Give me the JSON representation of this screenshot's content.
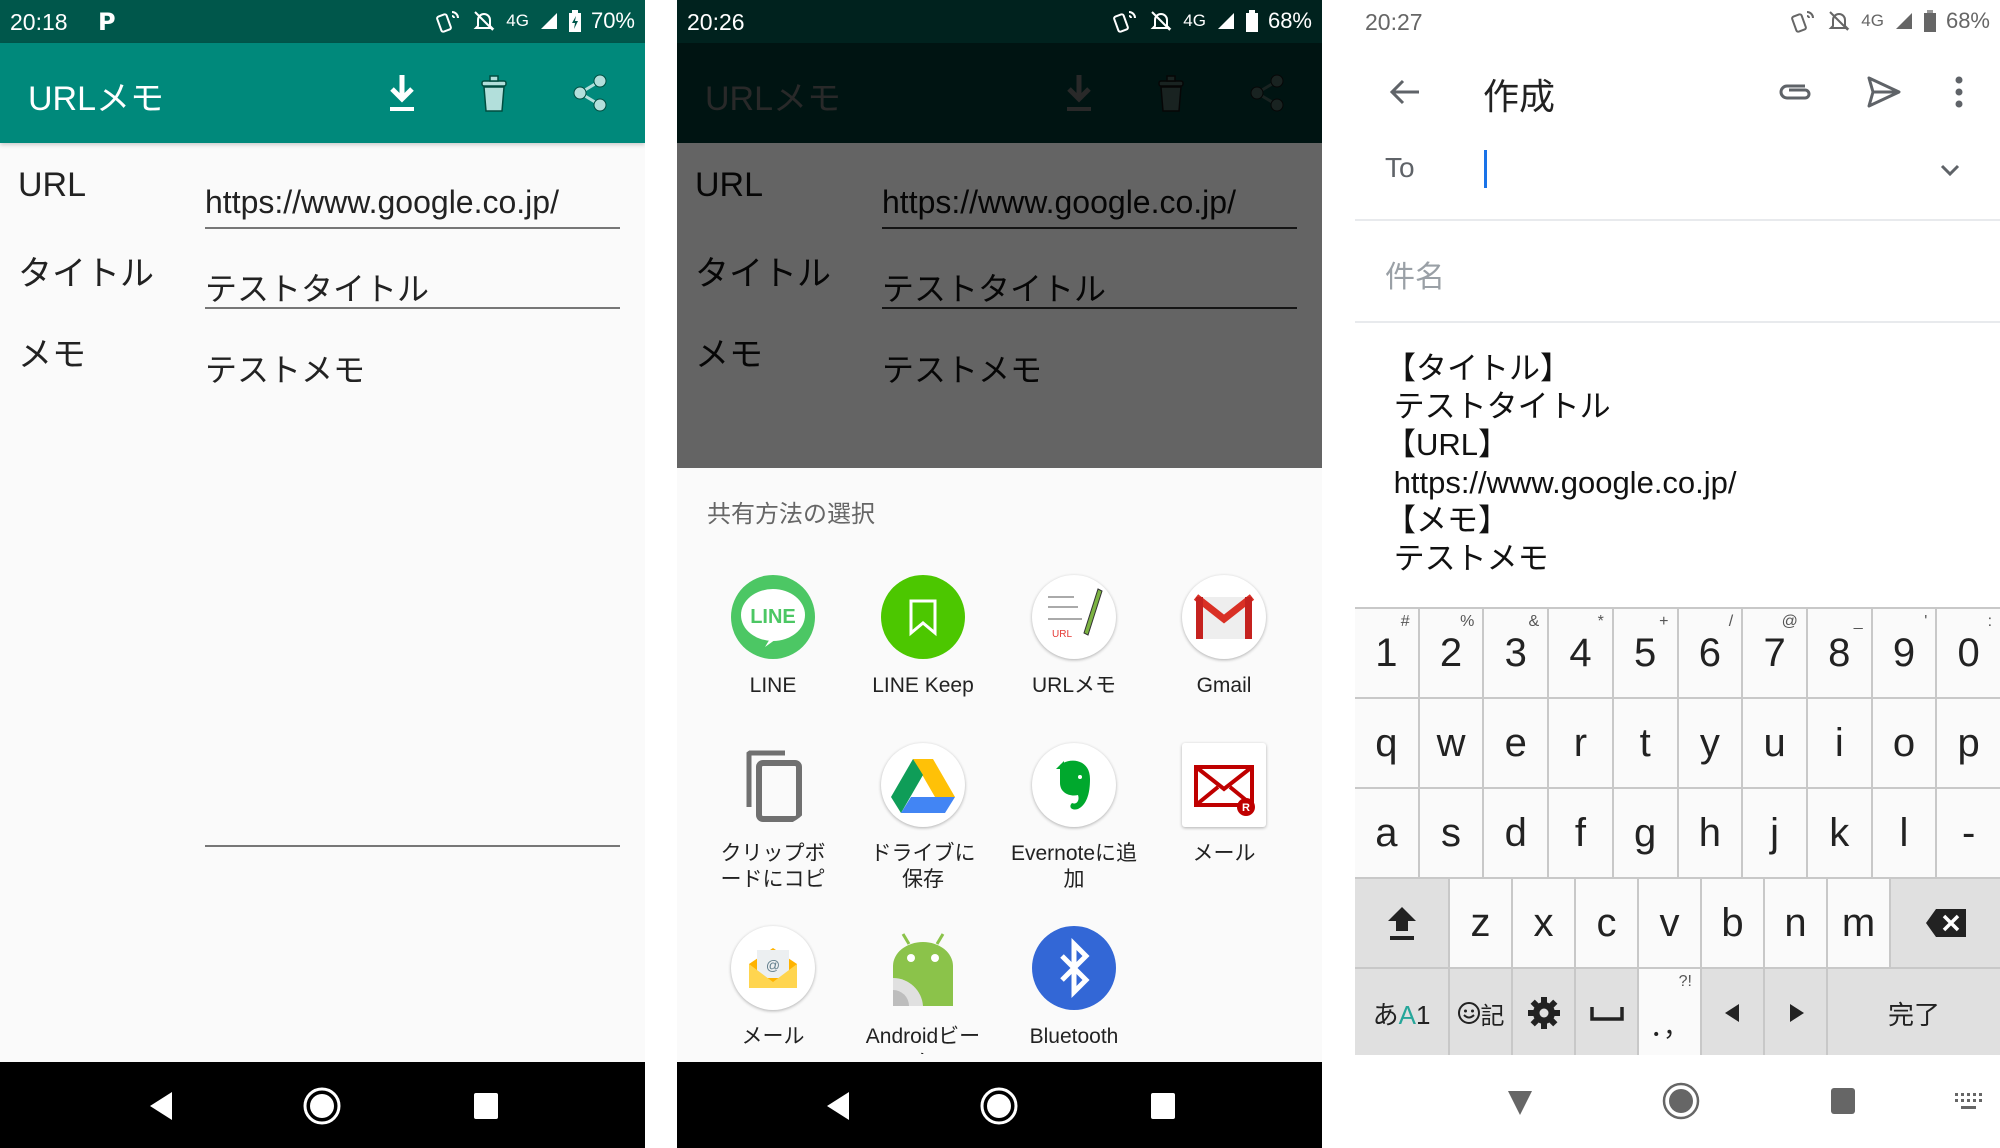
{
  "panel1": {
    "status": {
      "time": "20:18",
      "battery": "70%",
      "network": "4G"
    },
    "appbar": {
      "title": "URLメモ",
      "actions": [
        "download-icon",
        "delete-icon",
        "share-icon"
      ]
    },
    "form": {
      "url_label": "URL",
      "url_value": "https://www.google.co.jp/",
      "title_label": "タイトル",
      "title_value": "テストタイトル",
      "memo_label": "メモ",
      "memo_value": "テストメモ"
    }
  },
  "panel2": {
    "status": {
      "time": "20:26",
      "battery": "68%",
      "network": "4G"
    },
    "appbar": {
      "title": "URLメモ"
    },
    "form": {
      "url_label": "URL",
      "url_value": "https://www.google.co.jp/",
      "title_label": "タイトル",
      "title_value": "テストタイトル",
      "memo_label": "メモ",
      "memo_value": "テストメモ"
    },
    "share_sheet": {
      "title": "共有方法の選択",
      "apps": [
        {
          "label": "LINE",
          "icon": "line-icon"
        },
        {
          "label": "LINE Keep",
          "icon": "line-keep-icon"
        },
        {
          "label": "URLメモ",
          "icon": "url-memo-icon"
        },
        {
          "label": "Gmail",
          "icon": "gmail-icon"
        },
        {
          "label": "クリップボ\nードにコピ",
          "icon": "clipboard-icon"
        },
        {
          "label": "ドライブに\n保存",
          "icon": "google-drive-icon"
        },
        {
          "label": "Evernoteに追\n加",
          "icon": "evernote-icon"
        },
        {
          "label": "メール",
          "icon": "rakuten-mail-icon"
        },
        {
          "label": "メール",
          "icon": "email-icon"
        },
        {
          "label": "Androidビー\nム",
          "icon": "android-beam-icon"
        },
        {
          "label": "Bluetooth",
          "icon": "bluetooth-icon"
        }
      ]
    }
  },
  "panel3": {
    "status": {
      "time": "20:27",
      "battery": "68%",
      "network": "4G"
    },
    "toolbar": {
      "title": "作成"
    },
    "to_label": "To",
    "subject_placeholder": "件名",
    "body": "【タイトル】\n テストタイトル\n【URL】\n https://www.google.co.jp/\n【メモ】\n テストメモ",
    "keyboard": {
      "row1": [
        {
          "k": "1",
          "s": "#"
        },
        {
          "k": "2",
          "s": "%"
        },
        {
          "k": "3",
          "s": "&"
        },
        {
          "k": "4",
          "s": "*"
        },
        {
          "k": "5",
          "s": "+"
        },
        {
          "k": "6",
          "s": "/"
        },
        {
          "k": "7",
          "s": "@"
        },
        {
          "k": "8",
          "s": "_"
        },
        {
          "k": "9",
          "s": "'"
        },
        {
          "k": "0",
          "s": ":"
        }
      ],
      "row2": [
        "q",
        "w",
        "e",
        "r",
        "t",
        "y",
        "u",
        "i",
        "o",
        "p"
      ],
      "row3": [
        "a",
        "s",
        "d",
        "f",
        "g",
        "h",
        "j",
        "k",
        "l",
        "-"
      ],
      "row4": [
        "z",
        "x",
        "c",
        "v",
        "b",
        "n",
        "m"
      ],
      "mode_key": "あA1",
      "emoji_key": "記",
      "punct_key": "．，",
      "punct_sup": "?!",
      "done_key": "完了"
    }
  },
  "colors": {
    "primary": "#00897b",
    "primary_dark": "#00574b",
    "accent_cursor": "#1a73e8"
  }
}
